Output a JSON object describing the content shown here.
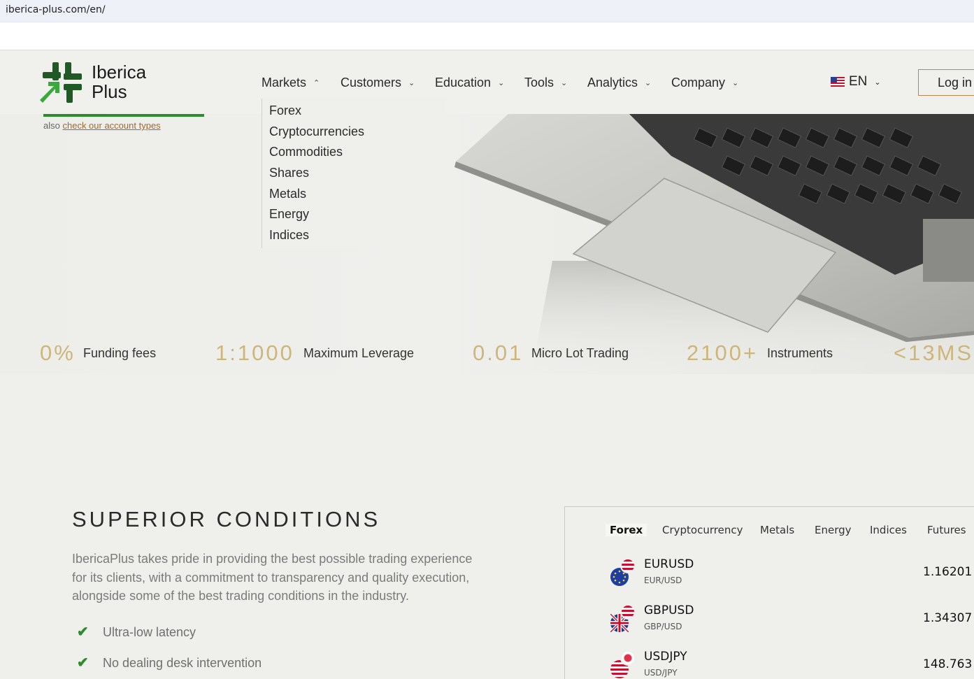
{
  "browser": {
    "url": "iberica-plus.com/en/"
  },
  "brand": {
    "line1": "Iberica",
    "line2": "Plus",
    "green": "#2e8b2e",
    "dark_green": "#1f5a24",
    "gold": "#cdb67a"
  },
  "nav": [
    {
      "label": "Markets",
      "icon": "chevron-up-icon"
    },
    {
      "label": "Customers",
      "icon": "chevron-down-icon"
    },
    {
      "label": "Education",
      "icon": "chevron-down-icon"
    },
    {
      "label": "Tools",
      "icon": "chevron-down-icon"
    },
    {
      "label": "Analytics",
      "icon": "chevron-down-icon"
    },
    {
      "label": "Company",
      "icon": "chevron-down-icon"
    }
  ],
  "lang": {
    "label": "EN",
    "flag": "us-flag-icon"
  },
  "login": "Log in",
  "markets_menu": [
    "Forex",
    "Cryptocurrencies",
    "Commodities",
    "Shares",
    "Metals",
    "Energy",
    "Indices"
  ],
  "account": {
    "prefix": "also",
    "link": "check our account types"
  },
  "stats": [
    {
      "value": "0%",
      "label": "Funding fees"
    },
    {
      "value": "1:1000",
      "label": "Maximum Leverage"
    },
    {
      "value": "0.01",
      "label": "Micro Lot Trading"
    },
    {
      "value": "2100+",
      "label": "Instruments"
    },
    {
      "value": "<13MS",
      "label": ""
    }
  ],
  "conditions": {
    "title": "SUPERIOR CONDITIONS",
    "text": "IbericaPlus takes pride in providing the best possible trading experience for its clients, with a commitment to transparency and quality execution, alongside some of the best trading conditions in the industry.",
    "bullets": [
      "Ultra-low latency",
      "No dealing desk intervention"
    ]
  },
  "quotes": {
    "tabs": [
      "Forex",
      "Cryptocurrency",
      "Metals",
      "Energy",
      "Indices",
      "Futures"
    ],
    "active_tab": "Forex",
    "rows": [
      {
        "symbol": "EURUSD",
        "pair": "EUR/USD",
        "price": "1.16201"
      },
      {
        "symbol": "GBPUSD",
        "pair": "GBP/USD",
        "price": "1.34307"
      },
      {
        "symbol": "USDJPY",
        "pair": "USD/JPY",
        "price": "148.763"
      }
    ]
  }
}
